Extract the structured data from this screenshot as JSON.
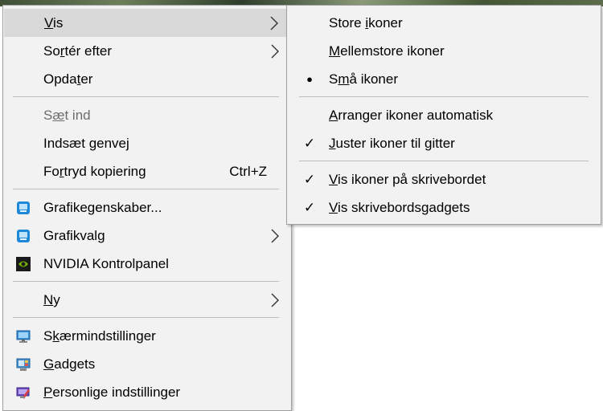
{
  "context_menu": {
    "items": [
      {
        "pre": "",
        "key": "V",
        "post": "is"
      },
      {
        "pre": "So",
        "key": "r",
        "post": "tér efter"
      },
      {
        "pre": "Opda",
        "key": "t",
        "post": "er"
      },
      {
        "pre": "S",
        "key": "æ",
        "post": "t ind"
      },
      {
        "pre": "Indsæt genve",
        "key": "j",
        "post": ""
      },
      {
        "pre": "Fo",
        "key": "r",
        "post": "tryd kopiering",
        "shortcut": "Ctrl+Z"
      },
      {
        "pre": "Grafikegenskaber...",
        "key": "",
        "post": ""
      },
      {
        "pre": "Grafikvalg",
        "key": "",
        "post": ""
      },
      {
        "pre": "NVIDIA Kontrolpanel",
        "key": "",
        "post": ""
      },
      {
        "pre": "",
        "key": "N",
        "post": "y"
      },
      {
        "pre": "S",
        "key": "k",
        "post": "ærmindstillinger"
      },
      {
        "pre": "",
        "key": "G",
        "post": "adgets"
      },
      {
        "pre": "",
        "key": "P",
        "post": "ersonlige indstillinger"
      }
    ]
  },
  "submenu": {
    "items": [
      {
        "pre": "Store ",
        "key": "i",
        "post": "koner",
        "mark": ""
      },
      {
        "pre": "",
        "key": "M",
        "post": "ellemstore ikoner",
        "mark": ""
      },
      {
        "pre": "S",
        "key": "m",
        "post": "å ikoner",
        "mark": "●"
      },
      {
        "pre": "",
        "key": "A",
        "post": "rranger ikoner automatisk",
        "mark": ""
      },
      {
        "pre": "",
        "key": "J",
        "post": "uster ikoner til gitter",
        "mark": "✓"
      },
      {
        "pre": "",
        "key": "V",
        "post": "is ikoner på skrivebordet",
        "mark": "✓"
      },
      {
        "pre": "",
        "key": "V",
        "post": "is skrivebordsgadgets",
        "mark": "✓"
      }
    ]
  },
  "icons": {
    "chevron": "chevron-right-icon",
    "graphics_properties": "intel-graphics-icon",
    "graphics_options": "intel-graphics-icon",
    "nvidia": "nvidia-logo-icon",
    "display": "display-settings-icon",
    "gadgets": "gadgets-icon",
    "personalize": "personalize-icon"
  },
  "colors": {
    "menu_bg": "#f2f2f2",
    "highlight": "#d9d9d9",
    "disabled_text": "#6d6d6d",
    "separator": "#bdbdbd"
  }
}
